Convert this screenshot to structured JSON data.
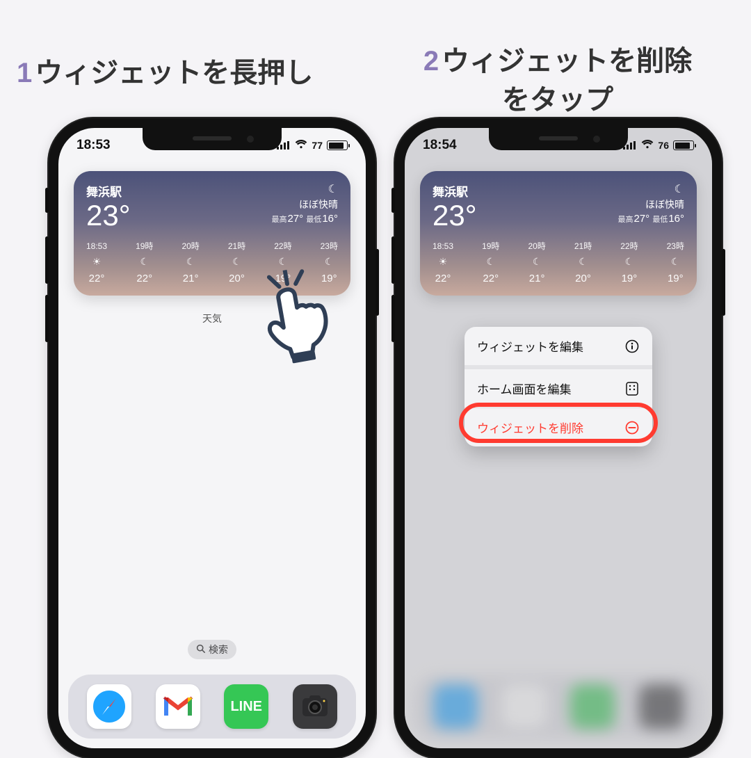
{
  "steps": {
    "s1": {
      "num": "1",
      "text": "ウィジェットを長押し"
    },
    "s2": {
      "num": "2",
      "line1": "ウィジェットを削除",
      "line2": "をタップ"
    }
  },
  "phone1": {
    "time": "18:53",
    "battery": "77",
    "widget_caption": "天気",
    "search_label": "検索"
  },
  "phone2": {
    "time": "18:54",
    "battery": "76"
  },
  "weather": {
    "location": "舞浜駅",
    "temp": "23°",
    "condition": "ほぼ快晴",
    "hi_label": "最高",
    "hi": "27°",
    "lo_label": "最低",
    "lo": "16°",
    "hours": [
      {
        "t": "18:53",
        "icon": "sunset",
        "temp": "22°"
      },
      {
        "t": "19時",
        "icon": "moon",
        "temp": "22°"
      },
      {
        "t": "20時",
        "icon": "moon",
        "temp": "21°"
      },
      {
        "t": "21時",
        "icon": "moon",
        "temp": "20°"
      },
      {
        "t": "22時",
        "icon": "moon",
        "temp": "19°"
      },
      {
        "t": "23時",
        "icon": "moon",
        "temp": "19°"
      }
    ]
  },
  "menu": {
    "edit_widget": "ウィジェットを編集",
    "edit_home": "ホーム画面を編集",
    "delete": "ウィジェットを削除"
  },
  "dock": {
    "apps": [
      "Safari",
      "Gmail",
      "LINE",
      "カメラ"
    ]
  }
}
